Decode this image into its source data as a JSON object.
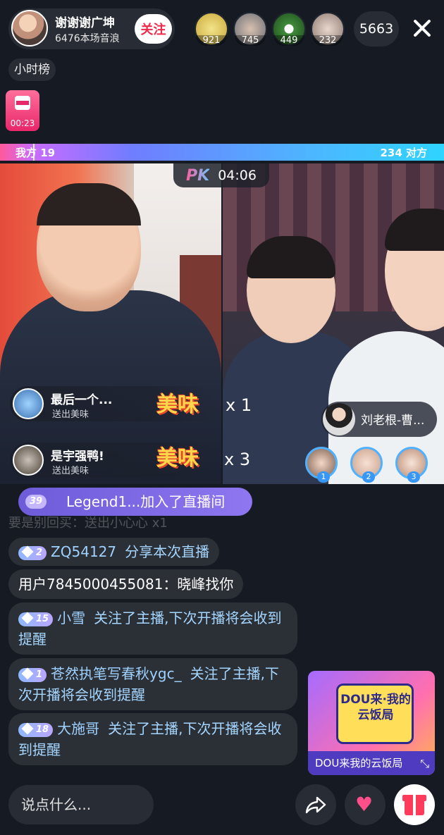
{
  "topbar": {
    "host_name": "谢谢谢广坤",
    "host_sub": "6476本场音浪",
    "follow_label": "关注",
    "fans": [
      {
        "count": "921",
        "color": "#e0c64b"
      },
      {
        "count": "745",
        "color": "#8a8f96"
      },
      {
        "count": "449",
        "color": "#3f8a3a"
      },
      {
        "count": "232",
        "color": "#b9a39a"
      }
    ],
    "viewers": "5663",
    "hour_rank": "小时榜",
    "timer_gift_time": "00:23"
  },
  "pk": {
    "mine_label": "我方 19",
    "theirs_label": "234 对方",
    "mine_score": 19,
    "theirs_score": 234,
    "logo": "PK",
    "time": "04:06"
  },
  "gift_banners": [
    {
      "title": "最后一个...",
      "sub": "送出美味",
      "gift": "美味",
      "combo": "x 1"
    },
    {
      "title": "是宇强鸭!",
      "sub": "送出美味",
      "gift": "美味",
      "combo": "x 3"
    }
  ],
  "rival": {
    "name": "刘老根-曹...",
    "ranks": [
      "1",
      "2",
      "3"
    ]
  },
  "comments": {
    "join": {
      "badge": "39",
      "text": "Legend1...加入了直播间"
    },
    "faded": "要是别回买：送出小心心 x1",
    "items": [
      {
        "badge": "2",
        "name": "ZQ54127",
        "text": "分享本次直播"
      },
      {
        "badge": "",
        "name": "",
        "text": "用户7845000455081：晓峰找你"
      },
      {
        "badge": "15",
        "name": "小雪",
        "text": "关注了主播,下次开播将会收到提醒"
      },
      {
        "badge": "1",
        "name": "苍然执笔写春秋ygc_",
        "text": "关注了主播,下次开播将会收到提醒"
      },
      {
        "badge": "18",
        "name": "大施哥",
        "text": "关注了主播,下次开播将会收到提醒"
      }
    ]
  },
  "promo": {
    "title": "DOU来·我的云饭局",
    "caption": "DOU来我的云饭局"
  },
  "bottom": {
    "input_placeholder": "说点什么..."
  }
}
